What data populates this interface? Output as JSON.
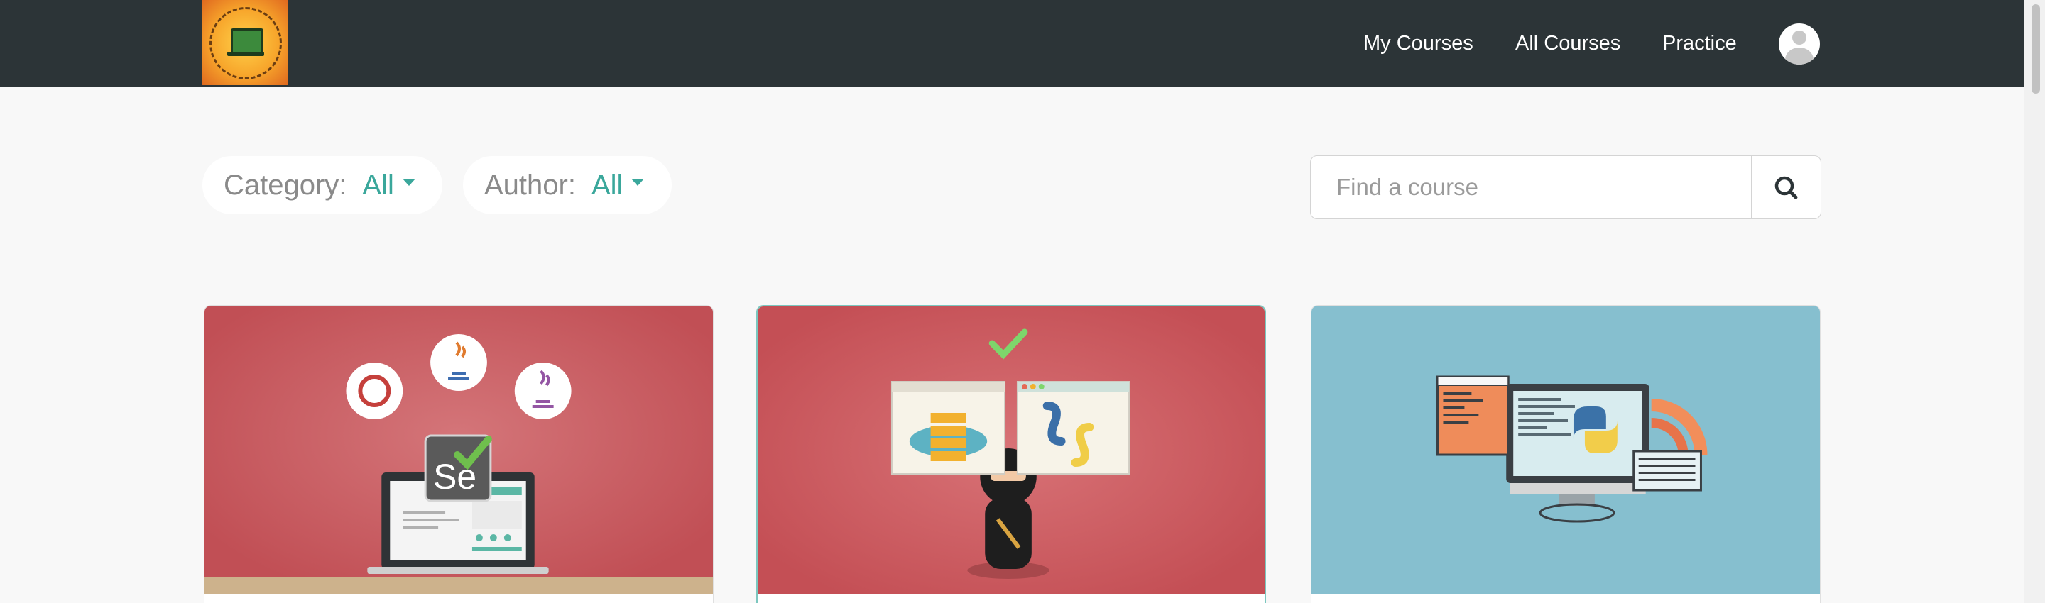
{
  "header": {
    "nav": [
      "My Courses",
      "All Courses",
      "Practice"
    ]
  },
  "filters": {
    "category": {
      "label": "Category:",
      "value": "All"
    },
    "author": {
      "label": "Author:",
      "value": "All"
    }
  },
  "search": {
    "placeholder": "Find a course"
  },
  "courses": [
    {
      "image": "selenium-java-laptop",
      "background": "#c9575b"
    },
    {
      "image": "ninja-server-python",
      "background": "#c9565b"
    },
    {
      "image": "python-monitor",
      "background": "#86bfcf"
    }
  ],
  "colors": {
    "accent": "#3aa79b",
    "header": "#2c3437"
  }
}
